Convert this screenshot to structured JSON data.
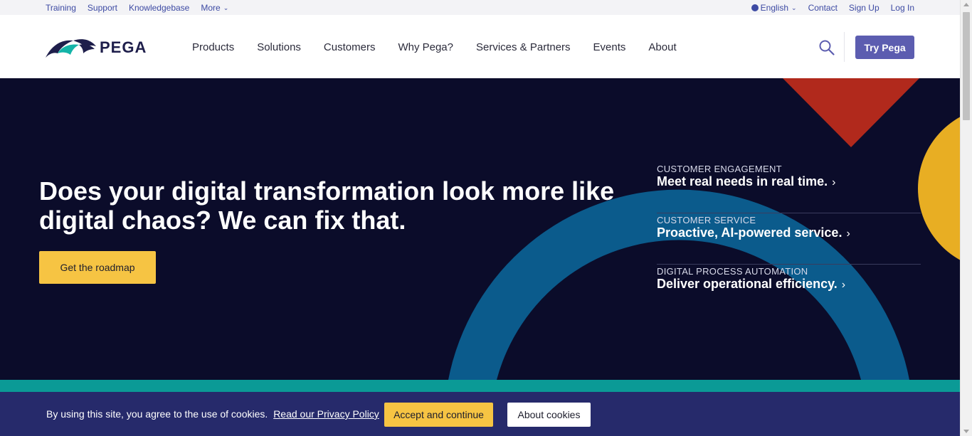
{
  "utility_nav": {
    "left": [
      "Training",
      "Support",
      "Knowledgebase",
      "More"
    ],
    "language": "English",
    "right": [
      "Contact",
      "Sign Up",
      "Log In"
    ]
  },
  "header": {
    "logo_text": "PEGA",
    "nav": [
      "Products",
      "Solutions",
      "Customers",
      "Why Pega?",
      "Services & Partners",
      "Events",
      "About"
    ],
    "try_button": "Try Pega"
  },
  "hero": {
    "headline": "Does your digital transformation look more like digital chaos? We can fix that.",
    "cta": "Get the roadmap",
    "topics": [
      {
        "label": "CUSTOMER ENGAGEMENT",
        "link": "Meet real needs in real time."
      },
      {
        "label": "CUSTOMER SERVICE",
        "link": "Proactive, AI-powered service."
      },
      {
        "label": "DIGITAL PROCESS AUTOMATION",
        "link": "Deliver operational efficiency."
      }
    ]
  },
  "cookie": {
    "text": "By using this site, you agree to the use of cookies.",
    "link": "Read our Privacy Policy",
    "accept": "Accept and continue",
    "about": "About cookies"
  },
  "colors": {
    "hero_bg": "#0b0c2a",
    "accent_yellow": "#f6c443",
    "brand_purple": "#5c5db0",
    "teal": "#0b9a96",
    "ring_blue": "#0b5b8c",
    "triangle_red": "#b1291c",
    "cookie_bg": "#262a6b"
  }
}
